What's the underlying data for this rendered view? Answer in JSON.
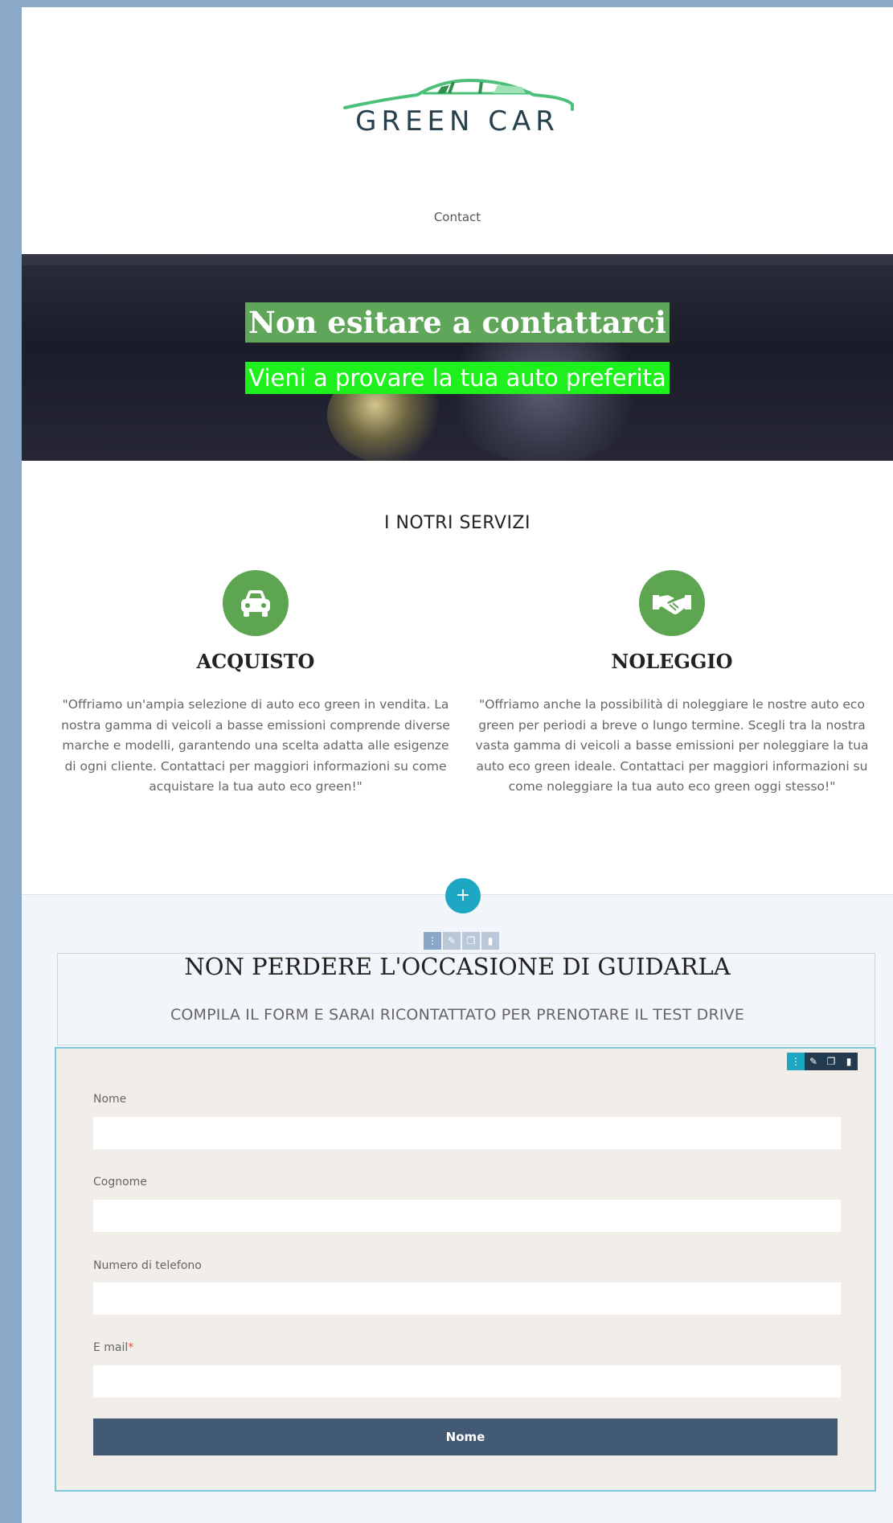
{
  "header": {
    "logo_text": "GREEN CAR",
    "nav_contact": "Contact"
  },
  "hero": {
    "title": "Non esitare a contattarci",
    "subtitle": "Vieni a provare la tua auto preferita"
  },
  "services": {
    "title": "I NOTRI SERVIZI",
    "items": [
      {
        "icon": "car-icon",
        "title": "ACQUISTO",
        "text": "\"Offriamo un'ampia selezione di auto eco green in vendita. La nostra gamma di veicoli a basse emissioni comprende diverse marche e modelli, garantendo una scelta adatta alle esigenze di ogni cliente. Contattaci per maggiori informazioni su come acquistare la tua auto eco green!\""
      },
      {
        "icon": "handshake-icon",
        "title": "NOLEGGIO",
        "text": "\"Offriamo anche la possibilità di noleggiare le nostre auto eco green per periodi a breve o lungo termine. Scegli tra la nostra vasta gamma di veicoli a basse emissioni per noleggiare la tua auto eco green ideale. Contattaci per maggiori informazioni su come noleggiare la tua auto eco green oggi stesso!\""
      }
    ]
  },
  "cta": {
    "title": "NON PERDERE L'OCCASIONE DI GUIDARLA",
    "subtitle": "COMPILA IL FORM E SARAI RICONTATTATO PER PRENOTARE IL TEST DRIVE"
  },
  "editor": {
    "add_label": "+"
  },
  "form": {
    "fields": [
      {
        "label": "Nome",
        "required": false,
        "value": ""
      },
      {
        "label": "Cognome",
        "required": false,
        "value": ""
      },
      {
        "label": "Numero di telefono",
        "required": false,
        "value": ""
      },
      {
        "label": "E mail",
        "required": true,
        "value": ""
      }
    ],
    "required_marker": "*",
    "submit_label": "Nome"
  },
  "colors": {
    "brand_green": "#5ea552",
    "hero_subtitle_bg": "#1ef01e",
    "button": "#435a74",
    "editor_accent": "#1ea7c2"
  }
}
